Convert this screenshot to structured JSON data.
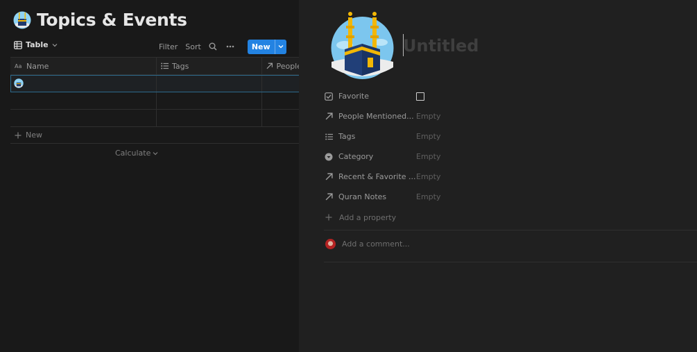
{
  "database": {
    "title": "Topics & Events",
    "icon": "kaaba-emoji-icon",
    "view_label": "Table",
    "toolbar": {
      "filter_label": "Filter",
      "sort_label": "Sort",
      "new_label": "New"
    },
    "columns": [
      {
        "label": "Name",
        "icon": "text-property-icon"
      },
      {
        "label": "Tags",
        "icon": "list-property-icon"
      },
      {
        "label": "People",
        "icon": "relation-arrow-icon"
      }
    ],
    "rows": [
      {
        "name": "",
        "selected": true
      },
      {
        "name": "",
        "selected": false
      },
      {
        "name": "",
        "selected": false
      }
    ],
    "add_row_label": "New",
    "calculate_label": "Calculate"
  },
  "peek": {
    "title_placeholder": "Untitled",
    "properties": [
      {
        "label": "Favorite",
        "icon": "checkbox-property-icon",
        "value": "",
        "type": "checkbox"
      },
      {
        "label": "People Mentioned...",
        "icon": "relation-arrow-icon",
        "value": "Empty"
      },
      {
        "label": "Tags",
        "icon": "list-property-icon",
        "value": "Empty"
      },
      {
        "label": "Category",
        "icon": "select-property-icon",
        "value": "Empty"
      },
      {
        "label": "Recent & Favorite ...",
        "icon": "relation-arrow-icon",
        "value": "Empty"
      },
      {
        "label": "Quran Notes",
        "icon": "relation-arrow-icon",
        "value": "Empty"
      }
    ],
    "add_property_label": "Add a property",
    "comment_placeholder": "Add a comment..."
  },
  "colors": {
    "accent": "#2383e2",
    "background": "#191919",
    "peek_background": "#202020"
  }
}
